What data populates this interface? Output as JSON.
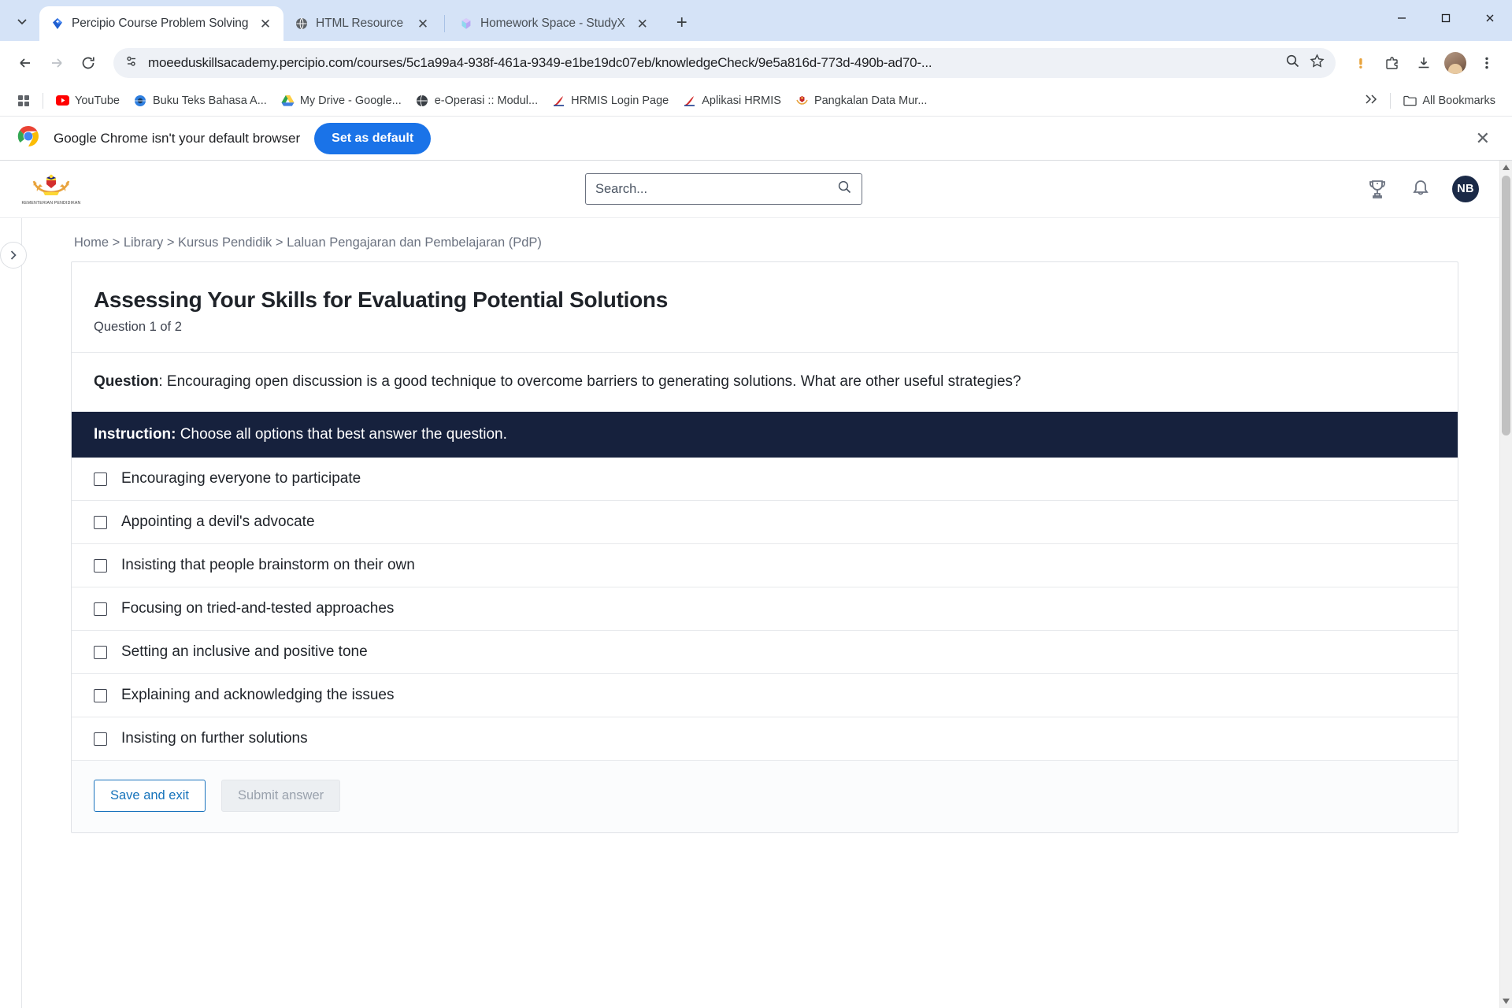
{
  "browser": {
    "tabs": [
      {
        "title": "Percipio Course Problem Solving",
        "favicon": "percipio-diamond-icon",
        "active": true
      },
      {
        "title": "HTML Resource",
        "favicon": "globe-icon",
        "active": false
      },
      {
        "title": "Homework Space - StudyX",
        "favicon": "studyx-hex-icon",
        "active": false
      }
    ],
    "new_tab_label": "+",
    "tab_list_icon": "chevron-down-icon",
    "window_controls": {
      "minimize": "—",
      "maximize": "☐",
      "close": "✕"
    },
    "nav": {
      "back_icon": "arrow-back-icon",
      "forward_icon": "arrow-forward-icon",
      "reload_icon": "reload-icon"
    },
    "omnibox": {
      "site_info_icon": "tune-icon",
      "url": "moeeduskillsacademy.percipio.com/courses/5c1a99a4-938f-461a-9349-e1be19dc07eb/knowledgeCheck/9e5a816d-773d-490b-ad70-...",
      "zoom_icon": "search-zoom-icon",
      "bookmark_icon": "star-icon"
    },
    "toolbar_right": {
      "update_icon": "pending-update-icon",
      "extensions_icon": "extensions-puzzle-icon",
      "downloads_icon": "download-icon",
      "profile_icon": "profile-avatar",
      "menu_icon": "three-dot-menu-icon"
    },
    "bookmarks": {
      "apps_icon": "apps-grid-icon",
      "items": [
        {
          "label": "YouTube",
          "icon": "youtube-icon"
        },
        {
          "label": "Buku Teks Bahasa A...",
          "icon": "globe-blue-icon"
        },
        {
          "label": "My Drive - Google...",
          "icon": "google-drive-icon"
        },
        {
          "label": "e-Operasi :: Modul...",
          "icon": "globe-dark-icon"
        },
        {
          "label": "HRMIS Login Page",
          "icon": "hrmis-icon"
        },
        {
          "label": "Aplikasi HRMIS",
          "icon": "hrmis-icon"
        },
        {
          "label": "Pangkalan Data Mur...",
          "icon": "jata-negara-icon"
        }
      ],
      "overflow_icon": "double-chevron-right-icon",
      "all_bookmarks": {
        "label": "All Bookmarks",
        "icon": "folder-icon"
      }
    },
    "default_bar": {
      "chrome_icon": "chrome-logo-icon",
      "message": "Google Chrome isn't your default browser",
      "button_label": "Set as default",
      "close_icon": "close-icon"
    }
  },
  "site": {
    "logo": {
      "name": "jata-negara-logo",
      "caption": "KEMENTERIAN PENDIDIKAN"
    },
    "search": {
      "placeholder": "Search...",
      "value": "",
      "icon": "search-icon"
    },
    "header_icons": [
      {
        "name": "trophy-icon"
      },
      {
        "name": "bell-notification-icon"
      }
    ],
    "avatar": {
      "initials": "NB"
    },
    "sidebar_toggle_icon": "chevron-right-icon",
    "breadcrumb": {
      "items": [
        "Home",
        "Library",
        "Kursus Pendidik",
        "Laluan Pengajaran dan Pembelajaran (PdP)"
      ],
      "separator": ">",
      "text": "Home > Library > Kursus Pendidik > Laluan Pengajaran dan Pembelajaran (PdP)"
    }
  },
  "assessment": {
    "title": "Assessing Your Skills for Evaluating Potential Solutions",
    "progress": "Question 1 of 2",
    "question_label": "Question",
    "question_text": ": Encouraging open discussion is a good technique to overcome barriers to generating solutions. What are other useful strategies?",
    "instruction_label": "Instruction:",
    "instruction_text": " Choose all options that best answer the question.",
    "options": [
      {
        "label": "Encouraging everyone to participate",
        "checked": false
      },
      {
        "label": "Appointing a devil's advocate",
        "checked": false
      },
      {
        "label": "Insisting that people brainstorm on their own",
        "checked": false
      },
      {
        "label": "Focusing on tried-and-tested approaches",
        "checked": false
      },
      {
        "label": "Setting an inclusive and positive tone",
        "checked": false
      },
      {
        "label": "Explaining and acknowledging the issues",
        "checked": false
      },
      {
        "label": "Insisting on further solutions",
        "checked": false
      }
    ],
    "save_label": "Save and exit",
    "submit_label": "Submit answer"
  },
  "colors": {
    "instruction_bg": "#16213d",
    "accent_blue": "#1a73e8",
    "link_blue": "#1673bb",
    "avatar_bg": "#1b2a47"
  },
  "scrollbar": {
    "up_icon": "triangle-up-icon",
    "down_icon": "triangle-down-icon"
  }
}
